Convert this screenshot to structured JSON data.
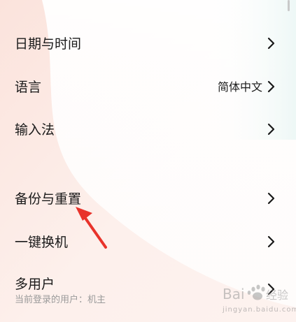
{
  "settings": {
    "items": [
      {
        "label": "日期与时间",
        "value": "",
        "sublabel": ""
      },
      {
        "label": "语言",
        "value": "简体中文",
        "sublabel": ""
      },
      {
        "label": "输入法",
        "value": "",
        "sublabel": ""
      },
      {
        "label": "备份与重置",
        "value": "",
        "sublabel": ""
      },
      {
        "label": "一键换机",
        "value": "",
        "sublabel": ""
      },
      {
        "label": "多用户",
        "value": "",
        "sublabel": "当前登录的用户：机主"
      }
    ]
  },
  "watermark": {
    "text": "jingyan.baidu.com",
    "logo": "Baidu 经验"
  },
  "colors": {
    "annotation_arrow": "#e8332b",
    "background_accent": "#f8d6cf"
  }
}
